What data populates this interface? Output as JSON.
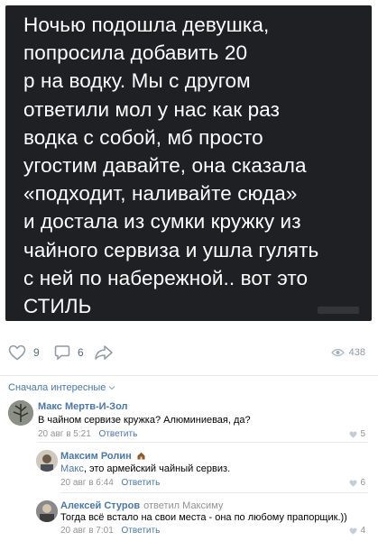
{
  "post": {
    "text": "Ночью подошла девушка,\nпопросила добавить 20\nр на водку. Мы с другом\nответили мол у нас как раз\nводка с собой, мб просто\nугостим давайте, она сказала\n«подходит, наливайте сюда»\nи достала из сумки кружку из\nчайного сервиза и ушла гулять\nс ней по набережной.. вот это\nСТИЛЬ"
  },
  "actions": {
    "likes": "9",
    "comments": "6",
    "views": "438"
  },
  "sort_label": "Сначала интересные",
  "comments": [
    {
      "author": "Макс Мертв-И-Зол",
      "text": "В чайном сервизе кружка? Алюминиевая, да?",
      "date": "20 авг в 5:21",
      "reply_label": "Ответить",
      "likes": "5"
    },
    {
      "author": "Максим Ролин",
      "mention": "Макс",
      "text": ", это армейский чайный сервиз.",
      "date": "20 авг в 6:44",
      "reply_label": "Ответить",
      "likes": "6"
    },
    {
      "author": "Алексей Стуров",
      "replied_to": "ответил Максиму",
      "text": "Тогда всё встало на свои места - она по любому прапорщик.))",
      "date": "20 авг в 7:01",
      "reply_label": "Ответить",
      "likes": "4"
    }
  ],
  "colors": {
    "link": "#4a76a8",
    "meta": "#939393",
    "image_bg": "#1f2023"
  }
}
